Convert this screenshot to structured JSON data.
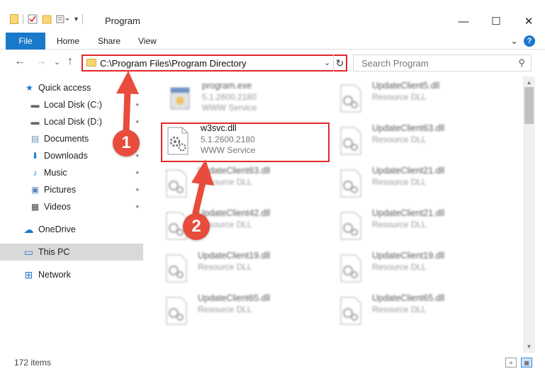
{
  "window": {
    "title": "Program",
    "minimize_glyph": "—",
    "maximize_glyph": "☐",
    "close_glyph": "✕"
  },
  "ribbon": {
    "tabs": [
      "File",
      "Home",
      "Share",
      "View"
    ],
    "help_glyph": "?",
    "expand_glyph": "⌄",
    "accent_color": "#1979ca"
  },
  "navigation": {
    "back_glyph": "←",
    "forward_glyph": "→",
    "recent_glyph": "⌄",
    "up_glyph": "↑",
    "address": "C:\\Program Files\\Program Directory",
    "address_dropdown_glyph": "⌄",
    "refresh_glyph": "↻",
    "search_placeholder": "Search Program",
    "search_glyph": "⚲"
  },
  "sidebar": {
    "items": [
      {
        "label": "Quick access",
        "icon": "star-icon",
        "glyph": "★"
      },
      {
        "label": "Local Disk (C:)",
        "icon": "drive-icon",
        "glyph": "▬"
      },
      {
        "label": "Local Disk (D:)",
        "icon": "drive-icon",
        "glyph": "▬"
      },
      {
        "label": "Documents",
        "icon": "document-icon",
        "glyph": "▤"
      },
      {
        "label": "Downloads",
        "icon": "download-icon",
        "glyph": "⬇"
      },
      {
        "label": "Music",
        "icon": "music-icon",
        "glyph": "♪"
      },
      {
        "label": "Pictures",
        "icon": "pictures-icon",
        "glyph": "▣"
      },
      {
        "label": "Videos",
        "icon": "video-icon",
        "glyph": "▦"
      },
      {
        "label": "OneDrive",
        "icon": "cloud-icon",
        "glyph": "☁"
      },
      {
        "label": "This PC",
        "icon": "computer-icon",
        "glyph": "▭"
      },
      {
        "label": "Network",
        "icon": "network-icon",
        "glyph": "⊞"
      }
    ],
    "pin_glyph": "✦"
  },
  "files": {
    "items": [
      {
        "name": "program.exe",
        "line1": "5.1.2600.2180",
        "line2": "WWW Service"
      },
      {
        "name": "UpdateClient5.dll",
        "line1": "Resource DLL",
        "line2": ""
      },
      {
        "name": "w3svc.dll",
        "line1": "5.1.2600.2180",
        "line2": "WWW Service"
      },
      {
        "name": "UpdateClient63.dll",
        "line1": "Resource DLL",
        "line2": ""
      },
      {
        "name": "UpdateClient63.dll",
        "line1": "Resource DLL",
        "line2": ""
      },
      {
        "name": "UpdateClient21.dll",
        "line1": "Resource DLL",
        "line2": ""
      },
      {
        "name": "UpdateClient42.dll",
        "line1": "Resource DLL",
        "line2": ""
      },
      {
        "name": "UpdateClient21.dll",
        "line1": "Resource DLL",
        "line2": ""
      },
      {
        "name": "UpdateClient19.dll",
        "line1": "Resource DLL",
        "line2": ""
      },
      {
        "name": "UpdateClient19.dll",
        "line1": "Resource DLL",
        "line2": ""
      },
      {
        "name": "UpdateClient65.dll",
        "line1": "Resource DLL",
        "line2": ""
      },
      {
        "name": "UpdateClient65.dll",
        "line1": "Resource DLL",
        "line2": ""
      }
    ]
  },
  "annotations": {
    "step1": "1",
    "step2": "2",
    "color": "#e74c3c"
  },
  "statusbar": {
    "item_count": "172 items",
    "details_glyph": "≡",
    "tiles_glyph": "▦"
  }
}
